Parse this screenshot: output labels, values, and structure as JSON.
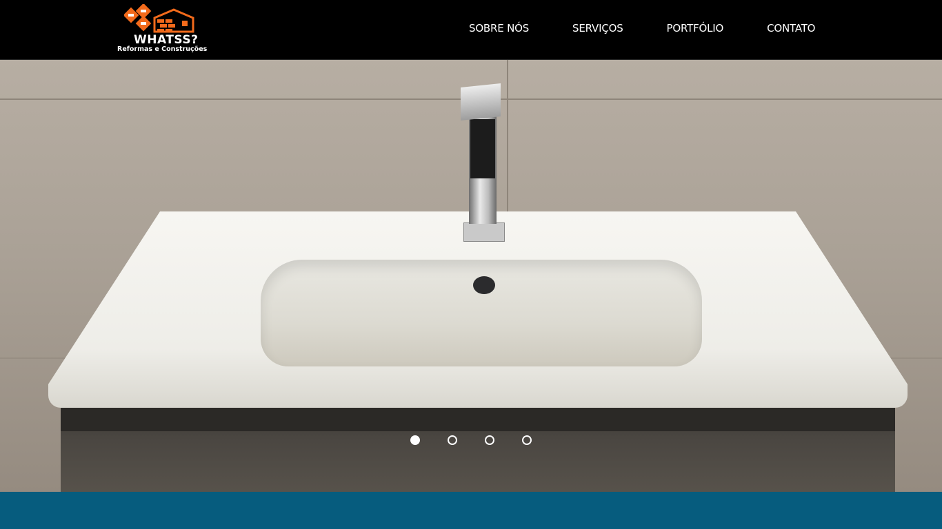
{
  "brand": {
    "name": "WHATSS?",
    "tagline": "Reformas e Construções",
    "logo_icon": "house-brick-tools-logo",
    "accent_color": "#f26a1b"
  },
  "nav": {
    "items": [
      {
        "label": "SOBRE NÓS"
      },
      {
        "label": "SERVIÇOS"
      },
      {
        "label": "PORTFÓLIO"
      },
      {
        "label": "CONTATO"
      }
    ]
  },
  "hero": {
    "image_icon": "bathroom-sink-photo",
    "slides_count": 4,
    "active_slide": 1
  },
  "colors": {
    "header_bg": "#000000",
    "footer_band": "#065c7e"
  }
}
